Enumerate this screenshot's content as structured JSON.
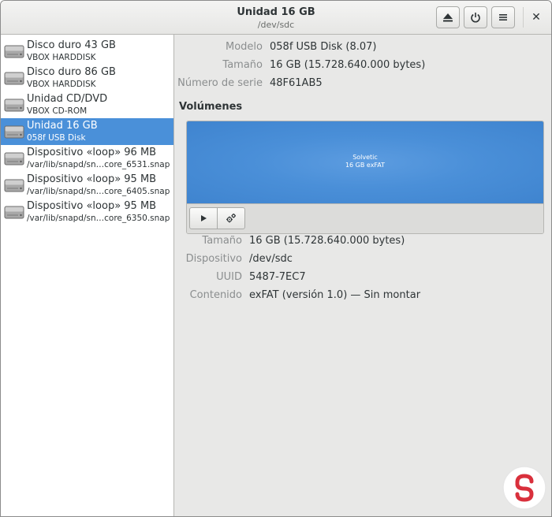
{
  "header": {
    "title": "Unidad 16 GB",
    "subtitle": "/dev/sdc"
  },
  "sidebar": {
    "drives": [
      {
        "name": "Disco duro 43 GB",
        "desc": "VBOX HARDDISK",
        "icon": "harddisk-icon"
      },
      {
        "name": "Disco duro 86 GB",
        "desc": "VBOX HARDDISK",
        "icon": "harddisk-icon"
      },
      {
        "name": "Unidad CD/DVD",
        "desc": "VBOX CD-ROM",
        "icon": "optical-drive-icon"
      },
      {
        "name": "Unidad 16 GB",
        "desc": "058f USB Disk",
        "icon": "usb-drive-icon",
        "selected": true
      },
      {
        "name": "Dispositivo «loop» 96 MB",
        "desc": "/var/lib/snapd/sn…core_6531.snap",
        "icon": "loop-device-icon"
      },
      {
        "name": "Dispositivo «loop» 95 MB",
        "desc": "/var/lib/snapd/sn…core_6405.snap",
        "icon": "loop-device-icon"
      },
      {
        "name": "Dispositivo «loop» 95 MB",
        "desc": "/var/lib/snapd/sn…core_6350.snap",
        "icon": "loop-device-icon"
      }
    ]
  },
  "drive_info": {
    "model_label": "Modelo",
    "model_value": "058f USB Disk (8.07)",
    "size_label": "Tamaño",
    "size_value": "16 GB (15.728.640.000 bytes)",
    "serial_label": "Número de serie",
    "serial_value": "48F61AB5"
  },
  "volumes": {
    "title": "Volúmenes",
    "volume_name": "Solvetic",
    "volume_desc": "16 GB exFAT"
  },
  "volume_info": {
    "size_label": "Tamaño",
    "size_value": "16 GB (15.728.640.000 bytes)",
    "device_label": "Dispositivo",
    "device_value": "/dev/sdc",
    "uuid_label": "UUID",
    "uuid_value": "5487-7EC7",
    "contents_label": "Contenido",
    "contents_value": "exFAT (versión 1.0) — Sin montar"
  },
  "colors": {
    "selection": "#4a90d9",
    "volume": "#4a8fd8",
    "logo_red": "#d9303c"
  }
}
